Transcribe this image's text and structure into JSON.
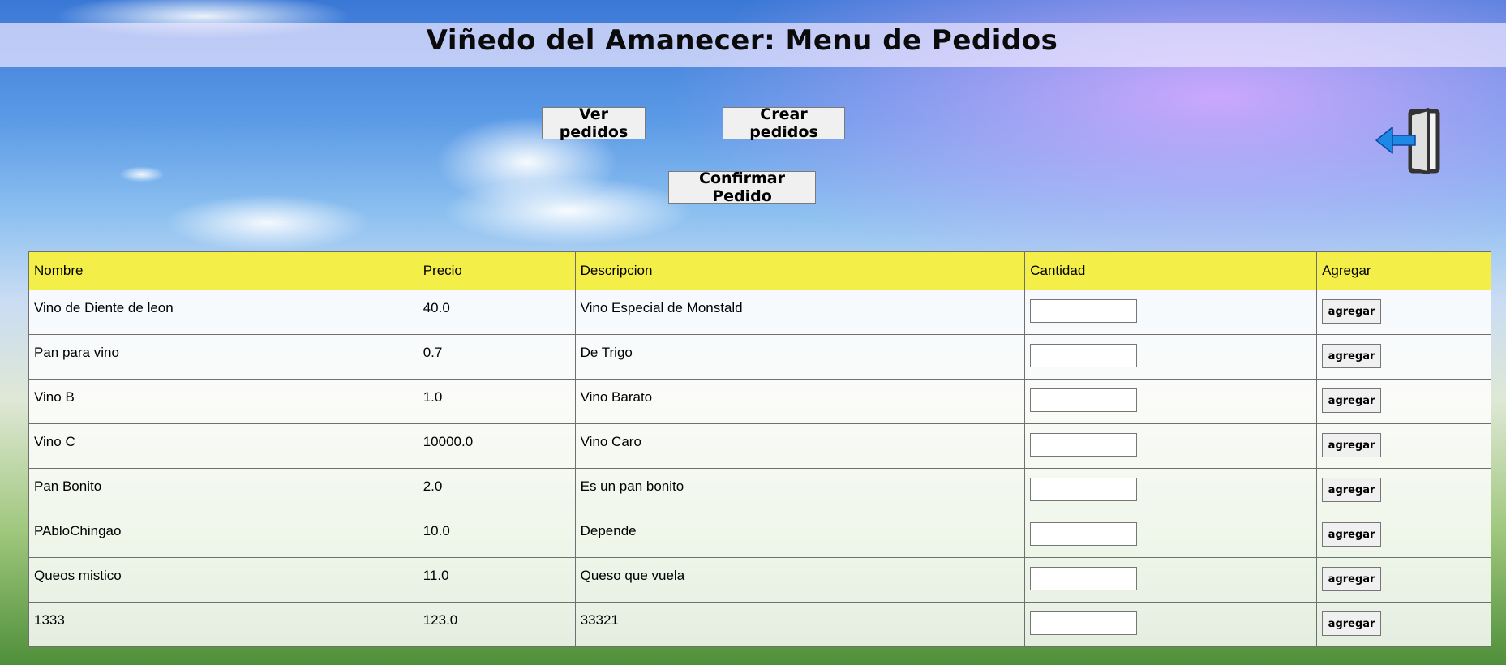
{
  "header": {
    "title": "Viñedo del Amanecer: Menu de Pedidos"
  },
  "actions": {
    "ver_pedidos": "Ver pedidos",
    "crear_pedidos": "Crear pedidos",
    "confirmar_pedido": "Confirmar Pedido",
    "logout_icon": "logout-door-arrow-icon"
  },
  "colors": {
    "header_row": "#f4ef48",
    "logout_arrow": "#1e88e5"
  },
  "table": {
    "columns": [
      "Nombre",
      "Precio",
      "Descripcion",
      "Cantidad",
      "Agregar"
    ],
    "add_label": "agregar",
    "rows": [
      {
        "nombre": "Vino de Diente de leon",
        "precio": "40.0",
        "descripcion": "Vino Especial de Monstald",
        "cantidad": ""
      },
      {
        "nombre": "Pan para vino",
        "precio": "0.7",
        "descripcion": "De Trigo",
        "cantidad": ""
      },
      {
        "nombre": "Vino B",
        "precio": "1.0",
        "descripcion": "Vino Barato",
        "cantidad": ""
      },
      {
        "nombre": "Vino C",
        "precio": "10000.0",
        "descripcion": "Vino Caro",
        "cantidad": ""
      },
      {
        "nombre": "Pan Bonito",
        "precio": "2.0",
        "descripcion": "Es un pan bonito",
        "cantidad": ""
      },
      {
        "nombre": "PAbloChingao",
        "precio": "10.0",
        "descripcion": "Depende",
        "cantidad": ""
      },
      {
        "nombre": "Queos mistico",
        "precio": "11.0",
        "descripcion": "Queso que vuela",
        "cantidad": ""
      },
      {
        "nombre": "1333",
        "precio": "123.0",
        "descripcion": "33321",
        "cantidad": ""
      }
    ]
  }
}
